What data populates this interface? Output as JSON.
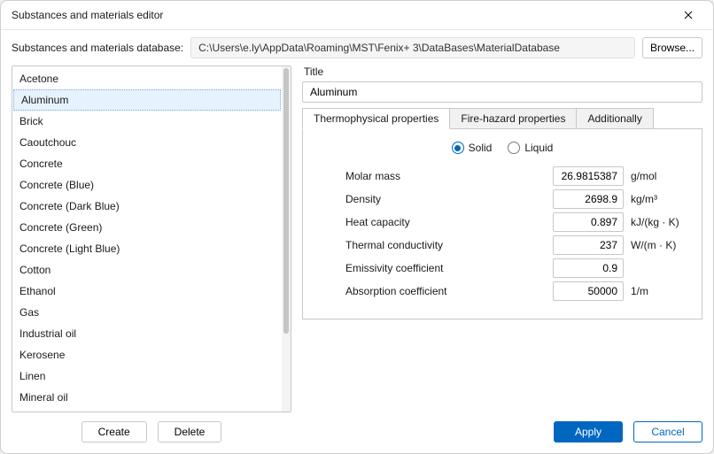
{
  "window": {
    "title": "Substances and materials editor"
  },
  "database": {
    "label": "Substances and materials database:",
    "path": "C:\\Users\\e.ly\\AppData\\Roaming\\MST\\Fenix+ 3\\DataBases\\MaterialDatabase",
    "browse_label": "Browse..."
  },
  "list": {
    "items": [
      "Acetone",
      "Aluminum",
      "Brick",
      "Caoutchouc",
      "Concrete",
      "Concrete (Blue)",
      "Concrete (Dark Blue)",
      "Concrete (Green)",
      "Concrete (Light Blue)",
      "Cotton",
      "Ethanol",
      "Gas",
      "Industrial oil",
      "Kerosene",
      "Linen",
      "Mineral oil"
    ],
    "selected_index": 1,
    "buttons": {
      "create": "Create",
      "delete": "Delete"
    }
  },
  "details": {
    "title_label": "Title",
    "title_value": "Aluminum",
    "tabs": [
      "Thermophysical properties",
      "Fire-hazard properties",
      "Additionally"
    ],
    "active_tab": 0,
    "phase": {
      "options": [
        "Solid",
        "Liquid"
      ],
      "selected": "Solid"
    },
    "properties": [
      {
        "label": "Molar mass",
        "value": "26.9815387",
        "unit": "g/mol"
      },
      {
        "label": "Density",
        "value": "2698.9",
        "unit": "kg/m³"
      },
      {
        "label": "Heat capacity",
        "value": "0.897",
        "unit": "kJ/(kg · K)"
      },
      {
        "label": "Thermal conductivity",
        "value": "237",
        "unit": "W/(m · K)"
      },
      {
        "label": "Emissivity coefficient",
        "value": "0.9",
        "unit": ""
      },
      {
        "label": "Absorption coefficient",
        "value": "50000",
        "unit": "1/m"
      }
    ]
  },
  "footer": {
    "apply": "Apply",
    "cancel": "Cancel"
  }
}
